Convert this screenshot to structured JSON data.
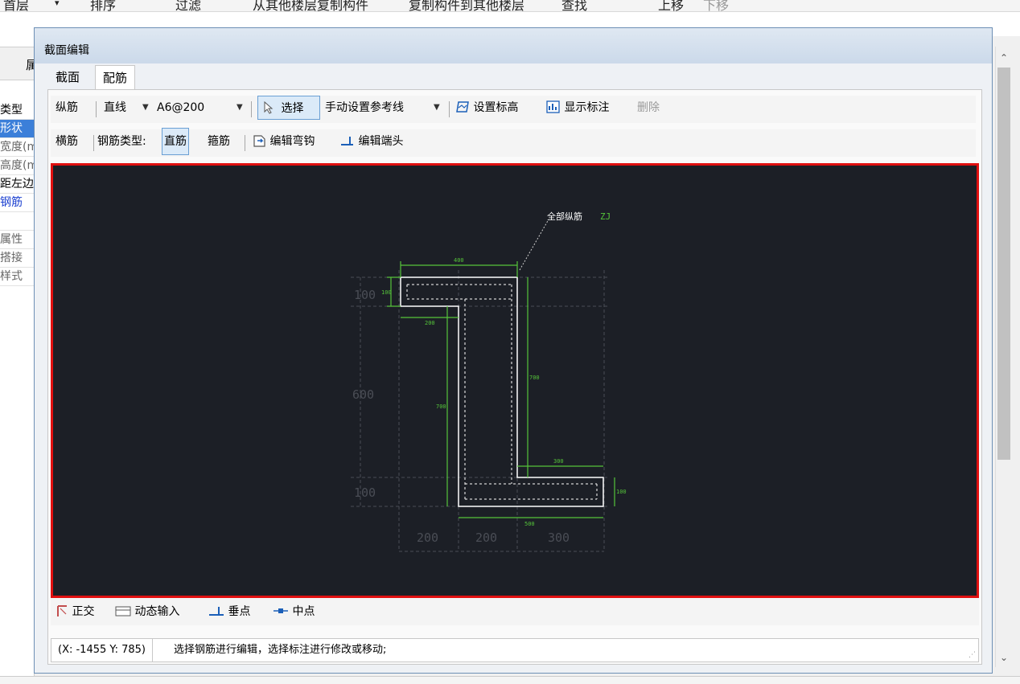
{
  "background": {
    "toolbar_items": [
      "首层",
      "▾",
      "排序",
      "过滤",
      "从其他楼层复制构件",
      "复制构件到其他楼层",
      "查找",
      "上移",
      "下移"
    ],
    "property_header": "属",
    "property_rows": [
      "类型",
      "形状",
      "宽度(m",
      "高度(m",
      "距左边",
      "钢筋",
      "",
      "属性",
      "搭接",
      "样式"
    ]
  },
  "dialog": {
    "title": "截面编辑",
    "tabs": [
      "截面",
      "配筋"
    ],
    "active_tab": "配筋"
  },
  "toolbar1": {
    "longitudinal": "纵筋",
    "line_type": "直线",
    "rebar_spec": "A6@200",
    "select": "选择",
    "manual_ref_line": "手动设置参考线",
    "set_elevation": "设置标高",
    "show_annotation": "显示标注",
    "delete": "删除"
  },
  "toolbar2": {
    "transverse": "横筋",
    "rebar_type_label": "钢筋类型:",
    "straight_rebar": "直筋",
    "stirrup": "箍筋",
    "edit_hook": "编辑弯钩",
    "edit_end": "编辑端头"
  },
  "canvas": {
    "label_all_long": "全部纵筋",
    "label_code": "ZJ",
    "dims_left": [
      "100",
      "600",
      "100"
    ],
    "dims_bottom": [
      "200",
      "200",
      "300"
    ],
    "rebar_dims": [
      "400",
      "100",
      "200",
      "700",
      "700",
      "300",
      "500",
      "100"
    ]
  },
  "bottom_toolbar": {
    "ortho": "正交",
    "dynamic_input": "动态输入",
    "perpendicular": "垂点",
    "midpoint": "中点"
  },
  "status": {
    "coordinates": "(X: -1455 Y: 785)",
    "message": "选择钢筋进行编辑，选择标注进行修改或移动;"
  },
  "colors": {
    "canvas_bg": "#1c1f26",
    "canvas_border": "#e01010",
    "rebar_green": "#55c43a",
    "section_white": "#ffffff",
    "dim_gray": "#4a4d55",
    "selection_blue": "#3b7fd9"
  }
}
